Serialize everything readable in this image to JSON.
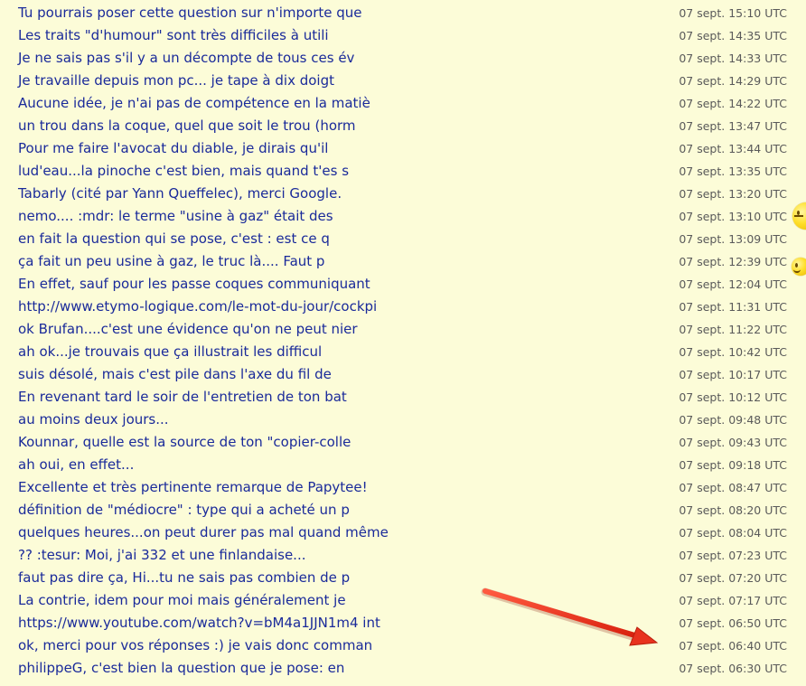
{
  "messages": [
    {
      "text": "Tu pourrais poser cette question sur n'importe que",
      "time": "07 sept. 15:10 UTC"
    },
    {
      "text": "Les traits \"d'humour\" sont très difficiles à utili",
      "time": "07 sept. 14:35 UTC"
    },
    {
      "text": "Je ne sais pas s'il y a un décompte de tous ces év",
      "time": "07 sept. 14:33 UTC"
    },
    {
      "text": "Je travaille depuis mon pc... je tape à dix doigt",
      "time": "07 sept. 14:29 UTC"
    },
    {
      "text": "Aucune idée, je n'ai pas de compétence en la matiè",
      "time": "07 sept. 14:22 UTC"
    },
    {
      "text": "un trou dans la coque, quel que soit le trou (horm",
      "time": "07 sept. 13:47 UTC"
    },
    {
      "text": "Pour me faire l'avocat du diable, je dirais qu'il",
      "time": "07 sept. 13:44 UTC"
    },
    {
      "text": "lud'eau...la pinoche c'est bien, mais quand t'es s",
      "time": "07 sept. 13:35 UTC"
    },
    {
      "text": "Tabarly (cité par Yann Queffelec), merci Google.",
      "time": "07 sept. 13:20 UTC"
    },
    {
      "text": "nemo.... :mdr: le terme \"usine à gaz\" était des",
      "time": "07 sept. 13:10 UTC"
    },
    {
      "text": "en fait la question qui se pose, c'est : est ce q",
      "time": "07 sept. 13:09 UTC"
    },
    {
      "text": "ça fait un peu usine à gaz, le truc là.... Faut p",
      "time": "07 sept. 12:39 UTC"
    },
    {
      "text": "En effet, sauf pour les passe coques communiquant",
      "time": "07 sept. 12:04 UTC"
    },
    {
      "text": "http://www.etymo-logique.com/le-mot-du-jour/cockpi",
      "time": "07 sept. 11:31 UTC"
    },
    {
      "text": "ok Brufan....c'est une évidence qu'on ne peut nier",
      "time": "07 sept. 11:22 UTC"
    },
    {
      "text": "ah ok...je trouvais que ça illustrait les difficul",
      "time": "07 sept. 10:42 UTC"
    },
    {
      "text": "suis désolé, mais c'est pile dans l'axe du fil de",
      "time": "07 sept. 10:17 UTC"
    },
    {
      "text": "En revenant tard le soir de l'entretien de ton bat",
      "time": "07 sept. 10:12 UTC"
    },
    {
      "text": "au moins deux jours...",
      "time": "07 sept. 09:48 UTC"
    },
    {
      "text": "Kounnar, quelle est la source de ton \"copier-colle",
      "time": "07 sept. 09:43 UTC"
    },
    {
      "text": "ah oui, en effet...",
      "time": "07 sept. 09:18 UTC"
    },
    {
      "text": "Excellente et très pertinente remarque de Papytee!",
      "time": "07 sept. 08:47 UTC"
    },
    {
      "text": "définition de \"médiocre\" : type qui a acheté un p",
      "time": "07 sept. 08:20 UTC"
    },
    {
      "text": "quelques heures...on peut durer pas mal quand même",
      "time": "07 sept. 08:04 UTC"
    },
    {
      "text": "?? :tesur: Moi, j'ai 332 et une finlandaise...",
      "time": "07 sept. 07:23 UTC"
    },
    {
      "text": "faut pas dire ça, Hi...tu ne sais pas combien de p",
      "time": "07 sept. 07:20 UTC"
    },
    {
      "text": "La contrie, idem pour moi mais généralement je",
      "time": "07 sept. 07:17 UTC"
    },
    {
      "text": "https://www.youtube.com/watch?v=bM4a1JJN1m4 int",
      "time": "07 sept. 06:50 UTC"
    },
    {
      "text": "ok, merci pour vos réponses :) je vais donc comman",
      "time": "07 sept. 06:40 UTC"
    },
    {
      "text": "philippeG, c'est bien la question que je pose: en",
      "time": "07 sept. 06:30 UTC"
    }
  ],
  "colors": {
    "background": "#fcfcd8",
    "link": "#1a2a9a",
    "timestamp": "#5a5a5a",
    "arrow": "#e8321e"
  },
  "icons": [
    "smiley-icon",
    "arrow-annotation-icon"
  ]
}
